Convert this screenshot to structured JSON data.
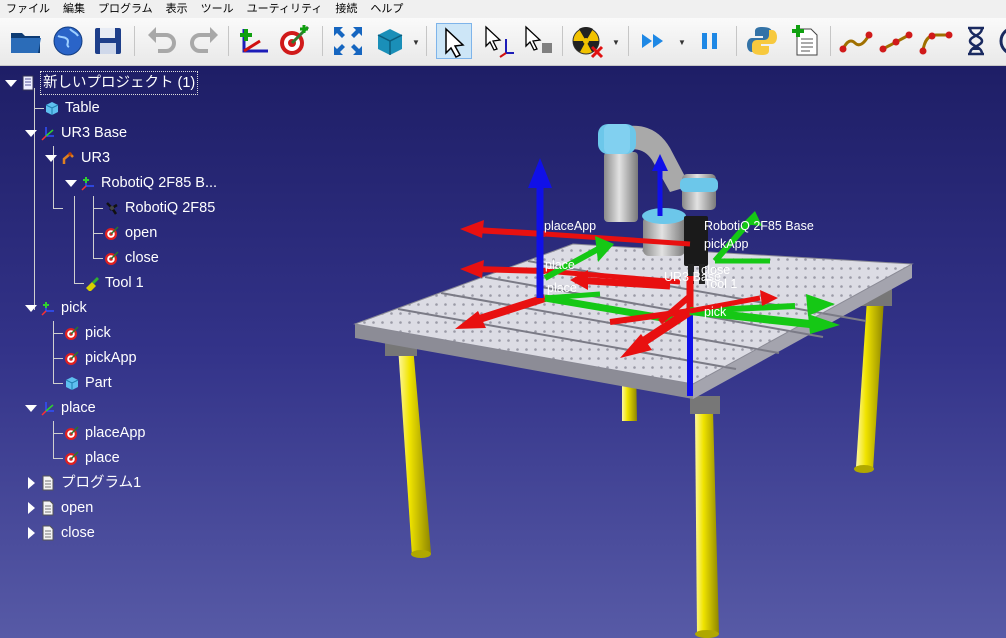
{
  "menu": [
    "ファイル",
    "編集",
    "プログラム",
    "表示",
    "ツール",
    "ユーティリティ",
    "接続",
    "ヘルプ"
  ],
  "toolbar": {
    "buttons": [
      "open-folder",
      "online-library",
      "save",
      "undo",
      "redo",
      "add-reference-frame",
      "add-target",
      "fit-all",
      "add-object",
      "select",
      "move-reference",
      "move-object",
      "collision-check",
      "run-program",
      "pause",
      "python",
      "add-program",
      "move-joint",
      "move-linear",
      "move-circular",
      "pause-instruction",
      "simulation-speed"
    ]
  },
  "tree": {
    "root": "新しいプロジェクト (1)",
    "items": [
      {
        "label": "Table",
        "icon": "object-icon"
      },
      {
        "label": "UR3 Base",
        "icon": "frame-icon"
      },
      {
        "label": "UR3",
        "icon": "robot-icon"
      },
      {
        "label": "RobotiQ 2F85 B...",
        "icon": "frame-icon"
      },
      {
        "label": "RobotiQ 2F85",
        "icon": "gripper-icon"
      },
      {
        "label": "open",
        "icon": "target-icon"
      },
      {
        "label": "close",
        "icon": "target-icon"
      },
      {
        "label": "Tool 1",
        "icon": "tool-icon"
      },
      {
        "label": "pick",
        "icon": "frame-icon"
      },
      {
        "label": "pick",
        "icon": "target-icon"
      },
      {
        "label": "pickApp",
        "icon": "target-icon"
      },
      {
        "label": "Part",
        "icon": "object-icon"
      },
      {
        "label": "place",
        "icon": "frame-icon"
      },
      {
        "label": "placeApp",
        "icon": "target-icon"
      },
      {
        "label": "place",
        "icon": "target-icon"
      },
      {
        "label": "プログラム1",
        "icon": "program-icon"
      },
      {
        "label": "open",
        "icon": "program-icon"
      },
      {
        "label": "close",
        "icon": "program-icon"
      }
    ]
  },
  "scene": {
    "labels": {
      "placeApp": "placeApp",
      "place1": "place",
      "place2": "place",
      "robotiq_base": "RobotiQ 2F85 Base",
      "pickApp": "pickApp",
      "close": "close",
      "tool1": "Tool 1",
      "ur3base": "UR3 Base",
      "pick": "pick"
    }
  },
  "colors": {
    "x_axis": "#e81010",
    "y_axis": "#15c815",
    "z_axis": "#1010e8",
    "table_legs": "#e8e000"
  }
}
